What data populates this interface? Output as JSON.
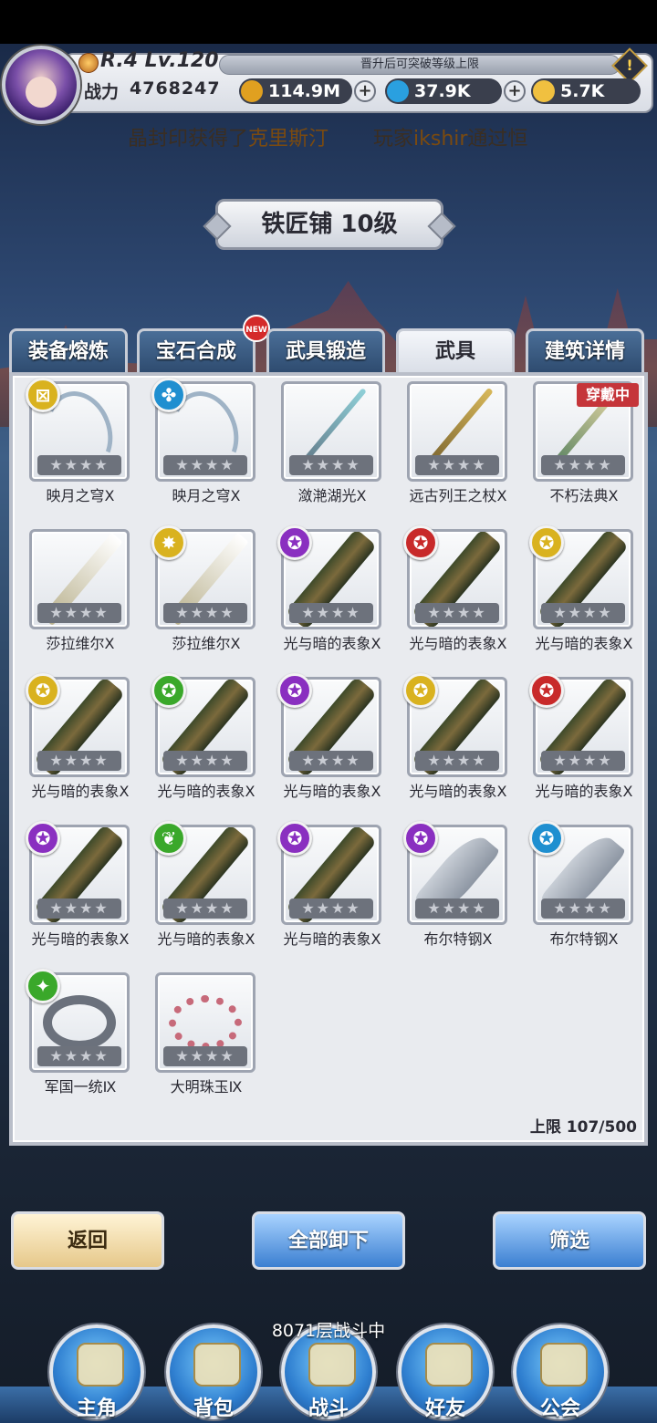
{
  "player": {
    "rank": "R.4 Lv.120",
    "rank_banner": "晋升后可突破等级上限",
    "power_label": "战力",
    "power_value": "4768247",
    "warn_icon": "!"
  },
  "resources": [
    {
      "name": "gold",
      "value": "114.9M",
      "color": "#e0a020"
    },
    {
      "name": "diamond",
      "value": "37.9K",
      "color": "#2aa0e0"
    },
    {
      "name": "crystal",
      "value": "5.7K",
      "color": "#f0c040"
    }
  ],
  "ticker": {
    "part1": "晶封印获得了",
    "highlight1": "克里斯汀",
    "part2": "玩家",
    "highlight2": "ikshir",
    "part3": "通过恒"
  },
  "title": "铁匠铺 10级",
  "tabs": [
    {
      "label": "装备熔炼"
    },
    {
      "label": "宝石合成",
      "badge": "NEW"
    },
    {
      "label": "武具锻造"
    },
    {
      "label": "武具",
      "active": true
    },
    {
      "label": "建筑详情"
    }
  ],
  "items": [
    {
      "name": "映月之穹Ⅹ",
      "elem": "⊠",
      "elem_color": "#d9b21f",
      "weapon": "bow"
    },
    {
      "name": "映月之穹Ⅹ",
      "elem": "✤",
      "elem_color": "#1f8fd0",
      "weapon": "bow"
    },
    {
      "name": "潋滟湖光Ⅹ",
      "weapon": "staff"
    },
    {
      "name": "远古列王之杖Ⅹ",
      "weapon": "spear"
    },
    {
      "name": "不朽法典Ⅹ",
      "weapon": "wand",
      "badge": "穿戴中"
    },
    {
      "name": "莎拉维尔Ⅹ",
      "weapon": "sword"
    },
    {
      "name": "莎拉维尔Ⅹ",
      "elem": "✸",
      "elem_color": "#d9b21f",
      "weapon": "sword"
    },
    {
      "name": "光与暗的表象Ⅹ",
      "elem": "✪",
      "elem_color": "#8a2fc0",
      "weapon": "blade"
    },
    {
      "name": "光与暗的表象Ⅹ",
      "elem": "✪",
      "elem_color": "#c82a2a",
      "weapon": "blade"
    },
    {
      "name": "光与暗的表象Ⅹ",
      "elem": "✪",
      "elem_color": "#d9b21f",
      "weapon": "blade"
    },
    {
      "name": "光与暗的表象Ⅹ",
      "elem": "✪",
      "elem_color": "#d9b21f",
      "weapon": "blade"
    },
    {
      "name": "光与暗的表象Ⅹ",
      "elem": "✪",
      "elem_color": "#3aa82a",
      "weapon": "blade"
    },
    {
      "name": "光与暗的表象Ⅹ",
      "elem": "✪",
      "elem_color": "#8a2fc0",
      "weapon": "blade"
    },
    {
      "name": "光与暗的表象Ⅹ",
      "elem": "✪",
      "elem_color": "#d9b21f",
      "weapon": "blade"
    },
    {
      "name": "光与暗的表象Ⅹ",
      "elem": "✪",
      "elem_color": "#c82a2a",
      "weapon": "blade"
    },
    {
      "name": "光与暗的表象Ⅹ",
      "elem": "✪",
      "elem_color": "#8a2fc0",
      "weapon": "blade"
    },
    {
      "name": "光与暗的表象Ⅹ",
      "elem": "❦",
      "elem_color": "#3aa82a",
      "weapon": "blade"
    },
    {
      "name": "光与暗的表象Ⅹ",
      "elem": "✪",
      "elem_color": "#8a2fc0",
      "weapon": "blade"
    },
    {
      "name": "布尔特钢Ⅹ",
      "elem": "✪",
      "elem_color": "#8a2fc0",
      "weapon": "scim"
    },
    {
      "name": "布尔特钢Ⅹ",
      "elem": "✪",
      "elem_color": "#1f8fd0",
      "weapon": "scim"
    },
    {
      "name": "军国一统Ⅸ",
      "elem": "✦",
      "elem_color": "#3aa82a",
      "weapon": "ring"
    },
    {
      "name": "大明珠玉Ⅸ",
      "weapon": "beads"
    }
  ],
  "stars": "★★★★",
  "capacity": "上限 107/500",
  "buttons": {
    "back": "返回",
    "unequip_all": "全部卸下",
    "filter": "筛选"
  },
  "battle_status": "8071层战斗中",
  "nav": [
    {
      "label": "主角",
      "icon": "hero-icon"
    },
    {
      "label": "背包",
      "icon": "backpack-icon"
    },
    {
      "label": "战斗",
      "icon": "swords-icon"
    },
    {
      "label": "好友",
      "icon": "handshake-icon"
    },
    {
      "label": "公会",
      "icon": "guild-icon"
    }
  ]
}
